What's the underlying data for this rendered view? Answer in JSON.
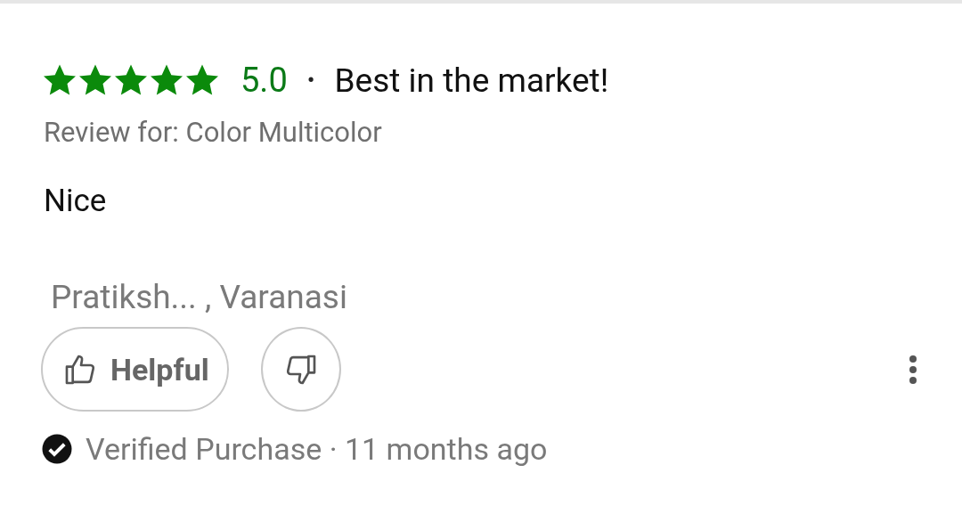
{
  "review": {
    "stars": 5,
    "rating": "5.0",
    "separator": "•",
    "title": "Best in the market!",
    "review_for": "Review for: Color Multicolor",
    "body": "Nice",
    "author": "Pratiksh... , Varanasi",
    "helpful_button": "Helpful",
    "meta": "Verified Purchase · 11 months ago"
  }
}
